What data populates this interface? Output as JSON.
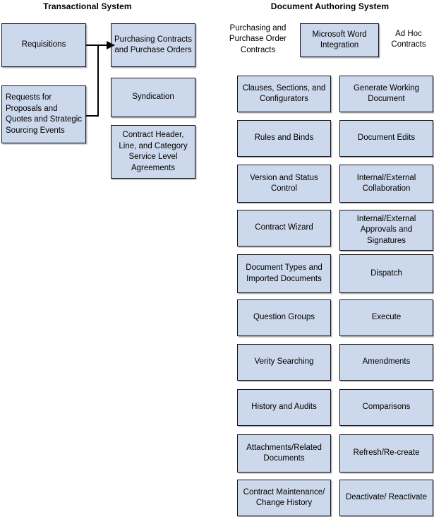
{
  "diagram": {
    "title_left": "Transactional System",
    "title_right": "Document Authoring System",
    "colors": {
      "node_fill": "#ccd8eb",
      "node_border": "#14141e",
      "background": "#ffffff",
      "connector": "#000000"
    }
  },
  "transactional_system": {
    "source_nodes": [
      {
        "label": "Requisitions"
      },
      {
        "label": "Requests for Proposals and Quotes and Strategic Sourcing Events"
      }
    ],
    "target_nodes": [
      {
        "label": "Purchasing Contracts and Purchase Orders"
      },
      {
        "label": "Syndication"
      },
      {
        "label": "Contract Header, Line, and Category Service Level Agreements"
      }
    ],
    "connections": [
      {
        "from": "Requisitions",
        "to": "Purchasing Contracts and Purchase Orders",
        "arrow": true
      },
      {
        "from": "Requests for Proposals and Quotes and Strategic Sourcing Events",
        "to": "Purchasing Contracts and Purchase Orders",
        "arrow": true
      }
    ]
  },
  "document_authoring_system": {
    "header": {
      "left_label": "Purchasing and Purchase Order Contracts",
      "center_node": "Microsoft Word Integration",
      "right_label": "Ad Hoc Contracts"
    },
    "left_column": [
      {
        "label": "Clauses, Sections, and Configurators"
      },
      {
        "label": "Rules and Binds"
      },
      {
        "label": "Version and Status Control"
      },
      {
        "label": "Contract Wizard"
      },
      {
        "label": "Document Types and Imported Documents"
      },
      {
        "label": "Question Groups"
      },
      {
        "label": "Verity Searching"
      },
      {
        "label": "History and Audits"
      },
      {
        "label": "Attachments/Related Documents"
      },
      {
        "label": "Contract Maintenance/ Change History"
      }
    ],
    "right_column": [
      {
        "label": "Generate Working Document"
      },
      {
        "label": "Document Edits"
      },
      {
        "label": "Internal/External Collaboration"
      },
      {
        "label": "Internal/External Approvals and Signatures"
      },
      {
        "label": "Dispatch"
      },
      {
        "label": "Execute"
      },
      {
        "label": "Amendments"
      },
      {
        "label": "Comparisons"
      },
      {
        "label": "Refresh/Re-create"
      },
      {
        "label": "Deactivate/ Reactivate"
      }
    ]
  }
}
